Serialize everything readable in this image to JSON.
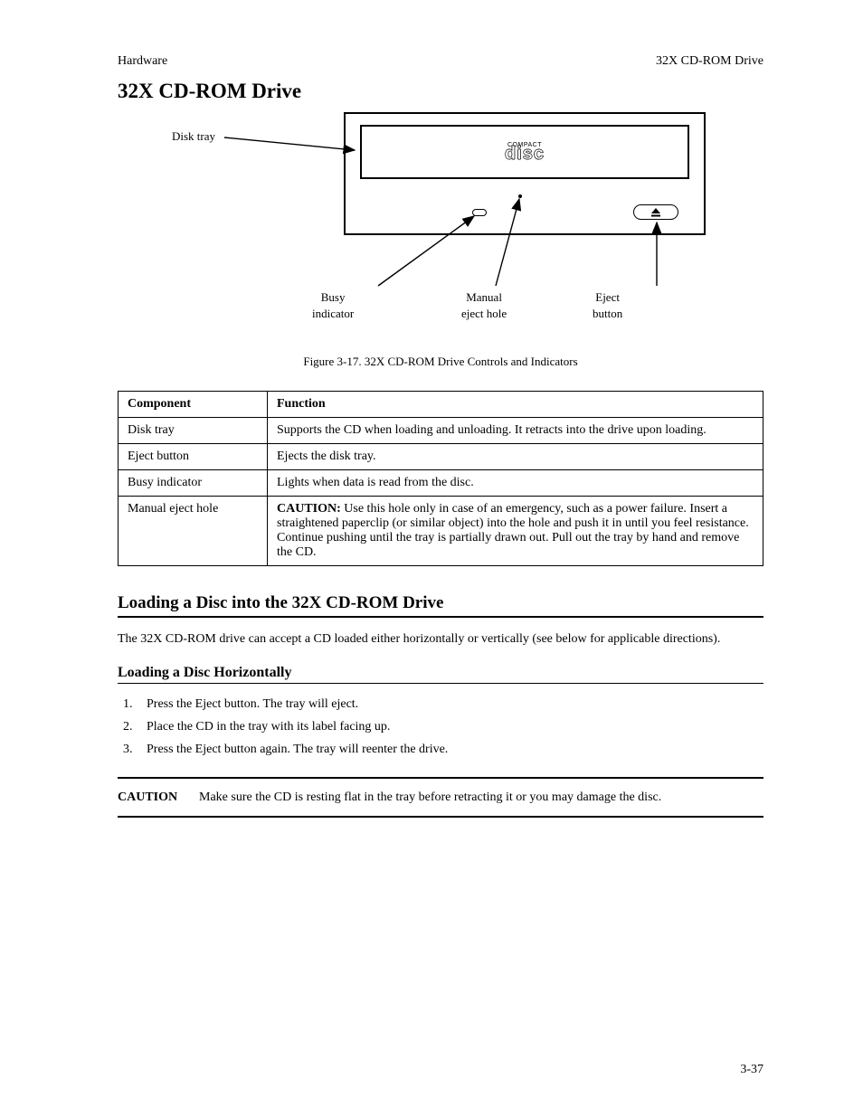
{
  "header": {
    "left": "Hardware",
    "right": "32X CD-ROM Drive"
  },
  "section_title": "32X CD-ROM Drive",
  "figure": {
    "callouts": {
      "tray": "Disk tray",
      "led": "Busy\nindicator",
      "hole": "Manual\neject hole",
      "eject": "Eject\nbutton"
    },
    "caption": "Figure 3-17. 32X CD-ROM Drive Controls and Indicators"
  },
  "table": {
    "headers": [
      "Component",
      "Function"
    ],
    "rows": [
      {
        "c1": "Disk tray",
        "c2": "Supports the CD when loading and unloading. It retracts into the drive upon loading."
      },
      {
        "c1": "Eject button",
        "c2": "Ejects the disk tray."
      },
      {
        "c1": "Busy indicator",
        "c2": "Lights when data is read from the disc."
      },
      {
        "c1": "Manual eject hole",
        "c2_prefix": "CAUTION:",
        "c2": " Use this hole only in case of an emergency, such as a power failure. Insert a straightened paperclip (or similar object) into the hole and push it in until you feel resistance. Continue pushing until the tray is partially drawn out. Pull out the tray by hand and remove the CD."
      }
    ]
  },
  "loading": {
    "title": "Loading a Disc into the 32X CD-ROM Drive",
    "intro": "The 32X CD-ROM drive can accept a CD loaded either horizontally or vertically (see below for applicable directions).",
    "horiz_title": "Loading a Disc Horizontally",
    "steps": [
      "Press the Eject button. The tray will eject.",
      "Place the CD in the tray with its label facing up.",
      "Press the Eject button again. The tray will reenter the drive."
    ]
  },
  "caution": {
    "label": "CAUTION",
    "text": "Make sure the CD is resting flat in the tray before retracting it or you may damage the disc."
  },
  "page_number": "3-37"
}
